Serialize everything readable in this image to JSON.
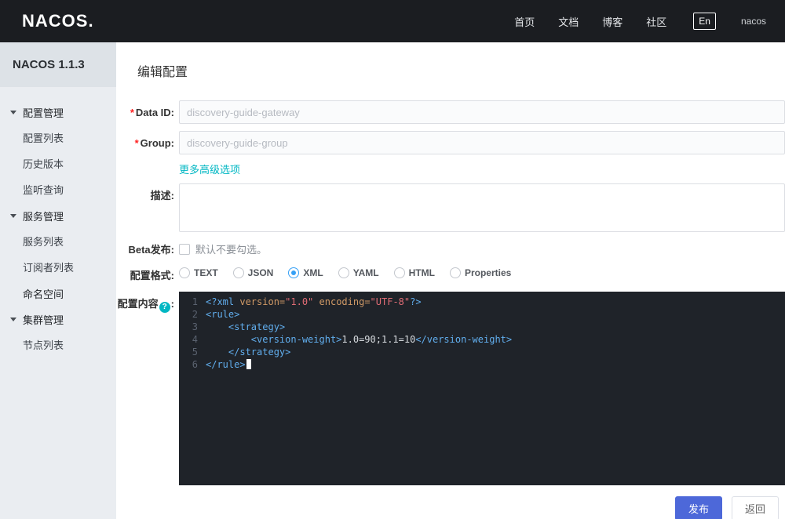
{
  "colors": {
    "navbar_bg": "#1b1d21",
    "sidebar_bg": "#eaedf1",
    "sidebar_header_bg": "#dde2e7",
    "accent_blue": "#36a0f5",
    "button_blue": "#4d68d9",
    "link_teal": "#00b7c3",
    "required_red": "#ff2121",
    "editor_bg": "#1f2329",
    "editor_gutter": "#5b6370",
    "tok_tag": "#61aeee",
    "tok_attr": "#d19a66",
    "tok_str": "#e06c75",
    "tok_plain": "#d6dade"
  },
  "navbar": {
    "logo": "NACOS.",
    "links": [
      {
        "key": "home",
        "label": "首页"
      },
      {
        "key": "docs",
        "label": "文档"
      },
      {
        "key": "blog",
        "label": "博客"
      },
      {
        "key": "community",
        "label": "社区"
      }
    ],
    "lang": "En",
    "user": "nacos"
  },
  "sidebar": {
    "version": "NACOS 1.1.3",
    "sections": [
      {
        "key": "config-management",
        "label": "配置管理",
        "expandable": true,
        "items": [
          {
            "key": "config-list",
            "label": "配置列表"
          },
          {
            "key": "history-versions",
            "label": "历史版本"
          },
          {
            "key": "listening-query",
            "label": "监听查询"
          }
        ]
      },
      {
        "key": "service-management",
        "label": "服务管理",
        "expandable": true,
        "items": [
          {
            "key": "service-list",
            "label": "服务列表"
          },
          {
            "key": "subscriber-list",
            "label": "订阅者列表"
          }
        ]
      },
      {
        "key": "namespace",
        "label": "命名空间",
        "expandable": false,
        "items": []
      },
      {
        "key": "cluster-management",
        "label": "集群管理",
        "expandable": true,
        "items": [
          {
            "key": "node-list",
            "label": "节点列表"
          }
        ]
      }
    ]
  },
  "main": {
    "title": "编辑配置",
    "form": {
      "required_mark": "*",
      "data_id": {
        "label": "Data ID:",
        "value": "discovery-guide-gateway"
      },
      "group": {
        "label": "Group:",
        "value": "discovery-guide-group"
      },
      "advanced_link": "更多高级选项",
      "description_label": "描述:",
      "description_value": "",
      "beta_label": "Beta发布:",
      "beta_checked": false,
      "beta_hint": "默认不要勾选。",
      "format_label": "配置格式:",
      "formats": [
        "TEXT",
        "JSON",
        "XML",
        "YAML",
        "HTML",
        "Properties"
      ],
      "format_selected": "XML",
      "content_label": "配置内容",
      "help_icon": "?",
      "content_colon": ":"
    },
    "editor": {
      "lines": [
        {
          "num": 1,
          "tokens": [
            {
              "c": "tag",
              "t": "<?xml "
            },
            {
              "c": "attr",
              "t": "version="
            },
            {
              "c": "str",
              "t": "\"1.0\""
            },
            {
              "c": "plain",
              "t": " "
            },
            {
              "c": "attr",
              "t": "encoding="
            },
            {
              "c": "str",
              "t": "\"UTF-8\""
            },
            {
              "c": "tag",
              "t": "?>"
            }
          ]
        },
        {
          "num": 2,
          "tokens": [
            {
              "c": "tag",
              "t": "<rule>"
            }
          ]
        },
        {
          "num": 3,
          "tokens": [
            {
              "c": "plain",
              "t": "    "
            },
            {
              "c": "tag",
              "t": "<strategy>"
            }
          ]
        },
        {
          "num": 4,
          "tokens": [
            {
              "c": "plain",
              "t": "        "
            },
            {
              "c": "tag",
              "t": "<version-weight>"
            },
            {
              "c": "plain",
              "t": "1.0=90;1.1=10"
            },
            {
              "c": "tag",
              "t": "</version-weight>"
            }
          ]
        },
        {
          "num": 5,
          "tokens": [
            {
              "c": "plain",
              "t": "    "
            },
            {
              "c": "tag",
              "t": "</strategy>"
            }
          ]
        },
        {
          "num": 6,
          "tokens": [
            {
              "c": "tag",
              "t": "</rule>"
            }
          ],
          "cursor": true
        }
      ]
    },
    "buttons": {
      "publish": "发布",
      "back": "返回"
    }
  }
}
